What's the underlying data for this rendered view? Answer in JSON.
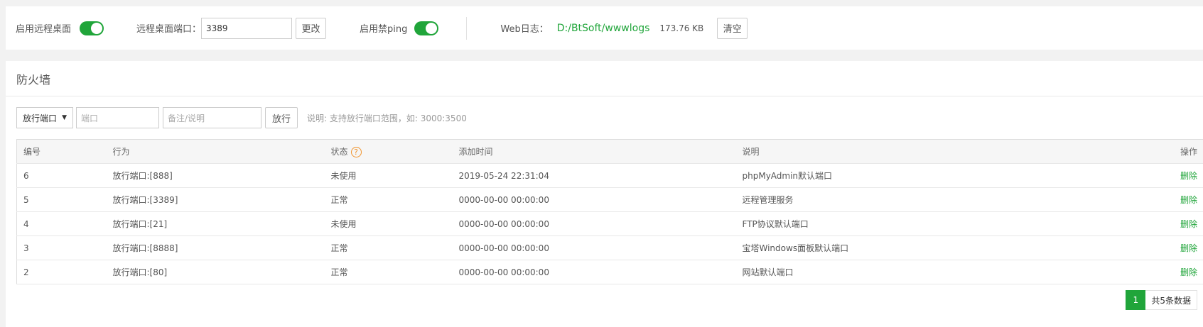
{
  "top": {
    "remote_desktop_label": "启用远程桌面",
    "remote_desktop_on": true,
    "port_label": "远程桌面端口：",
    "port_value": "3389",
    "change_button": "更改",
    "ping_label": "启用禁ping",
    "ping_on": true,
    "web_log_label": "Web日志：",
    "web_log_path": "D:/BtSoft/wwwlogs",
    "web_log_size": "173.76 KB",
    "clear_button": "清空"
  },
  "firewall": {
    "title": "防火墙",
    "mode_select": "放行端口",
    "port_placeholder": "端口",
    "note_placeholder": "备注/说明",
    "allow_button": "放行",
    "hint": "说明: 支持放行端口范围，如: 3000:3500",
    "columns": {
      "id": "编号",
      "action": "行为",
      "status": "状态",
      "status_help": "?",
      "added": "添加时间",
      "desc": "说明",
      "op": "操作"
    },
    "rows": [
      {
        "id": "6",
        "action": "放行端口:[888]",
        "status": "未使用",
        "added": "2019-05-24 22:31:04",
        "desc": "phpMyAdmin默认端口",
        "op": "删除"
      },
      {
        "id": "5",
        "action": "放行端口:[3389]",
        "status": "正常",
        "added": "0000-00-00 00:00:00",
        "desc": "远程管理服务",
        "op": "删除"
      },
      {
        "id": "4",
        "action": "放行端口:[21]",
        "status": "未使用",
        "added": "0000-00-00 00:00:00",
        "desc": "FTP协议默认端口",
        "op": "删除"
      },
      {
        "id": "3",
        "action": "放行端口:[8888]",
        "status": "正常",
        "added": "0000-00-00 00:00:00",
        "desc": "宝塔Windows面板默认端口",
        "op": "删除"
      },
      {
        "id": "2",
        "action": "放行端口:[80]",
        "status": "正常",
        "added": "0000-00-00 00:00:00",
        "desc": "网站默认端口",
        "op": "删除"
      }
    ],
    "pager": {
      "current": "1",
      "total": "共5条数据"
    }
  },
  "colors": {
    "accent": "#20a53a",
    "help": "#f0932b"
  }
}
